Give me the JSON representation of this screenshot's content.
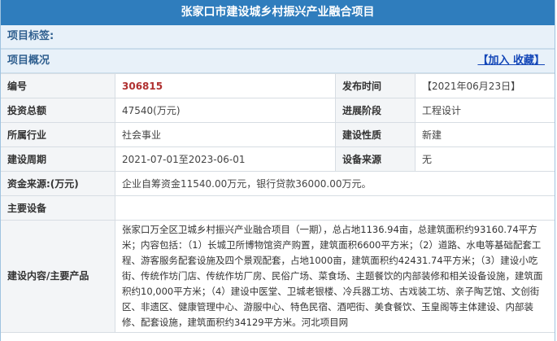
{
  "title": "张家口市建设城乡村振兴产业融合项目",
  "tags_label": "项目标签:",
  "overview_label": "项目概况",
  "favorite_link": "【加入 收藏】",
  "rows": {
    "code_label": "编号",
    "code_value": "306815",
    "publish_label": "发布时间",
    "publish_value": "【2021年06月23日】",
    "investment_label": "投资总额",
    "investment_value": "47540(万元)",
    "stage_label": "进展阶段",
    "stage_value": "工程设计",
    "industry_label": "所属行业",
    "industry_value": "社会事业",
    "nature_label": "建设性质",
    "nature_value": "新建",
    "period_label": "建设周期",
    "period_value": "2021-07-01至2023-06-01",
    "equip_source_label": "设备来源",
    "equip_source_value": "无",
    "funding_label": "资金来源:(万元)",
    "funding_value": "企业自筹资金11540.00万元，银行贷款36000.00万元。",
    "main_equip_label": "主要设备",
    "main_equip_value": "",
    "content_label": "建设内容/主要产品",
    "content_value": "张家口万全区卫城乡村振兴产业融合项目（一期），总占地1136.94亩，总建筑面积约93160.74平方米；内容包括：（1）长城卫所博物馆资产购置，建筑面积6600平方米；（2）道路、水电等基础配套工程、游客服务配套设施及四个景观配套，占地1000亩，建筑面积约42431.74平方米；（3）建设小吃街、传统作坊门店、传统作坊厂房、民俗广场、菜食场、主题餐饮的内部装修和相关设备设施，建筑面积约10,000平方米；（4）建设中医堂、卫城老银楼、冷兵器工坊、古戏装工坊、亲子陶艺馆、文创街区、非遗区、健康管理中心、游服中心、特色民宿、酒吧街、美食餐饮、玉皇阁等主体建设、内部装修、配套设施，建筑面积约34129平方米。河北项目网"
  }
}
